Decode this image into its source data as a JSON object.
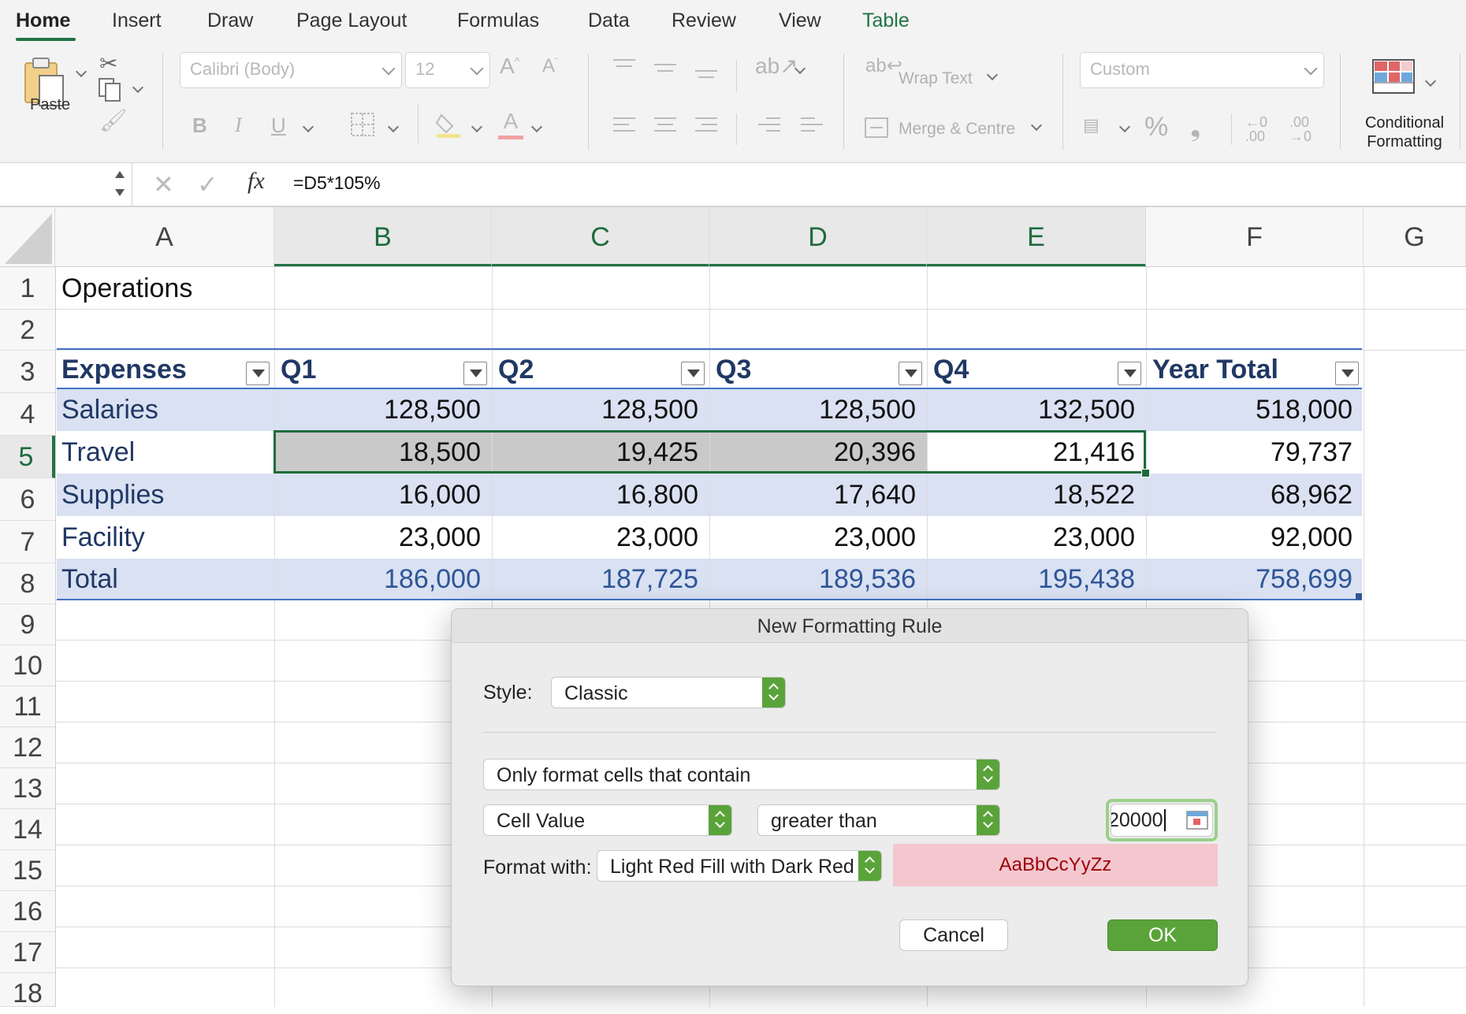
{
  "ribbon": {
    "tabs": [
      "Home",
      "Insert",
      "Draw",
      "Page Layout",
      "Formulas",
      "Data",
      "Review",
      "View",
      "Table"
    ],
    "paste_label": "Paste",
    "font_name": "Calibri (Body)",
    "font_size": "12",
    "wrap_text_label": "Wrap Text",
    "merge_label": "Merge & Centre",
    "number_format": "Custom",
    "conditional_formatting_label": "Conditional Formatting"
  },
  "formula_bar": {
    "formula": "=D5*105%",
    "fx": "fx"
  },
  "sheet": {
    "columns": [
      "A",
      "B",
      "C",
      "D",
      "E",
      "F",
      "G"
    ],
    "rows": [
      "1",
      "2",
      "3",
      "4",
      "5",
      "6",
      "7",
      "8",
      "9",
      "10",
      "11",
      "12",
      "13",
      "14",
      "15",
      "16",
      "17",
      "18"
    ],
    "title": "Operations",
    "table_headers": [
      "Expenses",
      "Q1",
      "Q2",
      "Q3",
      "Q4",
      "Year Total"
    ],
    "table_rows": [
      {
        "label": "Salaries",
        "values": [
          "128,500",
          "128,500",
          "128,500",
          "132,500",
          "518,000"
        ]
      },
      {
        "label": "Travel",
        "values": [
          "18,500",
          "19,425",
          "20,396",
          "21,416",
          "79,737"
        ]
      },
      {
        "label": "Supplies",
        "values": [
          "16,000",
          "16,800",
          "17,640",
          "18,522",
          "68,962"
        ]
      },
      {
        "label": "Facility",
        "values": [
          "23,000",
          "23,000",
          "23,000",
          "23,000",
          "92,000"
        ]
      },
      {
        "label": "Total",
        "values": [
          "186,000",
          "187,725",
          "189,536",
          "195,438",
          "758,699"
        ]
      }
    ]
  },
  "dialog": {
    "title": "New Formatting Rule",
    "style_label": "Style:",
    "style_value": "Classic",
    "rule_type": "Only format cells that contain",
    "condition_field": "Cell Value",
    "operator": "greater than",
    "value_input": "20000",
    "format_with_label": "Format with:",
    "format_with_value": "Light Red Fill with Dark Red T...",
    "preview_text": "AaBbCcYyZz",
    "cancel_label": "Cancel",
    "ok_label": "OK"
  },
  "colors": {
    "accent": "#217346",
    "table_band": "#d9e1f2",
    "table_text": "#203864",
    "preview_fill": "#f4c7ce",
    "preview_text": "#9c0006",
    "ok_button": "#5aa33a"
  }
}
